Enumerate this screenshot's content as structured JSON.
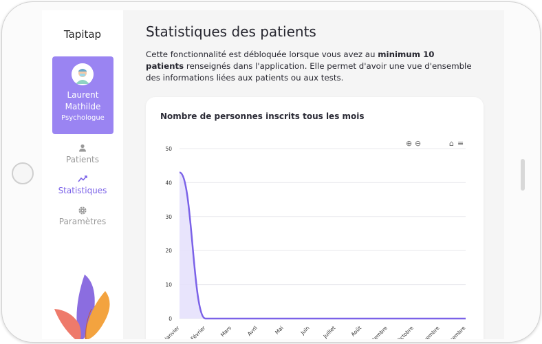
{
  "app": {
    "brand": "Tapitap"
  },
  "profile": {
    "first_name": "Laurent",
    "last_name": "Mathilde",
    "role": "Psychologue"
  },
  "nav": [
    {
      "label": "Patients",
      "icon": "person-icon"
    },
    {
      "label": "Statistiques",
      "icon": "chart-line-icon",
      "active": true
    },
    {
      "label": "Paramètres",
      "icon": "gear-icon"
    }
  ],
  "page": {
    "title": "Statistiques des patients",
    "desc_part1": "Cette fonctionnalité est débloquée lorsque vous avez au ",
    "desc_bold": "minimum 10 patients",
    "desc_part2": " renseignés dans l'application. Elle permet d'avoir une vue d'ensemble des informations liées aux patients ou aux tests."
  },
  "chart_data": {
    "type": "area",
    "title": "Nombre de personnes inscrits tous les mois",
    "categories": [
      "Janvier",
      "Février",
      "Mars",
      "Avril",
      "Mai",
      "Juin",
      "Juillet",
      "Août",
      "Septembre",
      "Octobre",
      "Novembre",
      "Décembre"
    ],
    "series": [
      {
        "values": [
          43,
          0,
          0,
          0,
          0,
          0,
          0,
          0,
          0,
          0,
          0,
          0
        ]
      }
    ],
    "ylim": [
      0,
      50
    ],
    "yticks": [
      0,
      10,
      20,
      30,
      40,
      50
    ],
    "grid": true,
    "line_color": "#7b62e8",
    "fill_color": "#e4dffb"
  },
  "toolbar": {
    "zoom_in": "⊕",
    "zoom_out": "⊖",
    "home": "⌂",
    "menu": "≡"
  },
  "colors": {
    "accent": "#7b62e8",
    "card_bg": "#9a84f2"
  }
}
